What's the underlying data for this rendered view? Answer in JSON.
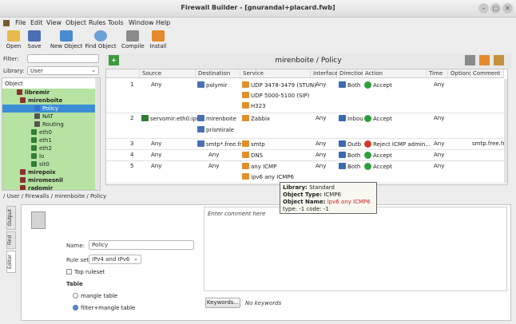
{
  "window": {
    "title": "Firewall Builder  - [gnurandal+placard.fwb]",
    "controls": [
      "–",
      "▢",
      "✕"
    ]
  },
  "menu": [
    "File",
    "Edit",
    "View",
    "Object",
    "Rules",
    "Tools",
    "Window",
    "Help"
  ],
  "toolbar": [
    {
      "label": "Open",
      "icon": "open-icon"
    },
    {
      "label": "Save",
      "icon": "save-icon"
    },
    {
      "label": "New Object",
      "icon": "new-object-icon"
    },
    {
      "label": "Find Object",
      "icon": "find-icon"
    },
    {
      "label": "Compile",
      "icon": "compile-icon"
    },
    {
      "label": "Install",
      "icon": "install-icon"
    }
  ],
  "left": {
    "filter_label": "Filter:",
    "filter_value": "",
    "library_label": "Library:",
    "library_value": "User",
    "tree_header": "Object",
    "tree": [
      {
        "label": "libremir",
        "indent": 18,
        "bold": true,
        "color": "#8b2f2f"
      },
      {
        "label": "mirenboite",
        "indent": 22,
        "bold": true,
        "color": "#8b2f2f"
      },
      {
        "label": "Policy",
        "indent": 40,
        "bold": false,
        "color": "#3b6fd0",
        "selected": true
      },
      {
        "label": "NAT",
        "indent": 40,
        "bold": false,
        "color": "#555"
      },
      {
        "label": "Routing",
        "indent": 40,
        "bold": false,
        "color": "#555"
      },
      {
        "label": "eth0",
        "indent": 36,
        "bold": false,
        "color": "#2e7d32"
      },
      {
        "label": "eth1",
        "indent": 36,
        "bold": false,
        "color": "#2e7d32"
      },
      {
        "label": "eth2",
        "indent": 36,
        "bold": false,
        "color": "#2e7d32"
      },
      {
        "label": "lo",
        "indent": 36,
        "bold": false,
        "color": "#2e7d32"
      },
      {
        "label": "sit0",
        "indent": 36,
        "bold": false,
        "color": "#2e7d32"
      },
      {
        "label": "mirepoix",
        "indent": 22,
        "bold": true,
        "color": "#8b2f2f"
      },
      {
        "label": "miromesnil",
        "indent": 22,
        "bold": true,
        "color": "#8b2f2f"
      },
      {
        "label": "radomir",
        "indent": 22,
        "bold": true,
        "color": "#8b2f2f"
      },
      {
        "label": "randomir",
        "indent": 22,
        "bold": true,
        "color": "#8b2f2f"
      }
    ]
  },
  "policy": {
    "title": "mirenboite / Policy",
    "columns": [
      "Source",
      "Destination",
      "Service",
      "Interface",
      "Direction",
      "Action",
      "Time",
      "Options",
      "Comment"
    ],
    "rows": [
      {
        "num": "1",
        "source": [
          "Any"
        ],
        "destination": [
          "polymir"
        ],
        "service": [
          "UDP 3478-3479 (STUN)",
          "UDP 5000-5100 (SIP)",
          "H323"
        ],
        "interface": "Any",
        "direction": "Both",
        "action": "Accept",
        "time": "Any",
        "comment": ""
      },
      {
        "num": "2",
        "source": [
          "servomir:eth0:ip6"
        ],
        "destination": [
          "mirenboite",
          "prismirale"
        ],
        "service": [
          "Zabbix"
        ],
        "interface": "Any",
        "direction": "Inbou",
        "action": "Accept",
        "time": "Any",
        "comment": ""
      },
      {
        "num": "3",
        "source": [
          "Any"
        ],
        "destination": [
          "smtp*.free.fr"
        ],
        "service": [
          "smtp"
        ],
        "interface": "Any",
        "direction": "Outb",
        "action": "Reject ICMP admin...",
        "time": "Any",
        "comment": "smtp.free.fr"
      },
      {
        "num": "4",
        "source": [
          "Any"
        ],
        "destination": [
          "Any"
        ],
        "service": [
          "DNS"
        ],
        "interface": "Any",
        "direction": "Both",
        "action": "Accept",
        "time": "Any",
        "comment": ""
      },
      {
        "num": "5",
        "source": [
          "Any"
        ],
        "destination": [
          "Any"
        ],
        "service": [
          "any ICMP",
          "ipv6 any ICMP6"
        ],
        "interface": "Any",
        "direction": "Both",
        "action": "Accept",
        "time": "Any",
        "comment": ""
      }
    ]
  },
  "tooltip": {
    "library_label": "Library:",
    "library": "Standard",
    "type_label": "Object Type:",
    "type": "ICMP6",
    "name_label": "Object Name:",
    "name": "ipv6 any ICMP6",
    "codes": "type: -1 code: -1"
  },
  "bottom": {
    "breadcrumb": "/ User / Firewalls / mirenboite / Policy",
    "tabs": [
      "Output",
      "Find",
      "Editor"
    ],
    "name_label": "Name:",
    "name_value": "Policy",
    "ruleset_label": "Rule set:",
    "ruleset_value": "IPv4 and IPv6",
    "top_ruleset": "Top ruleset",
    "table_label": "Table",
    "mangle_option": "mangle table",
    "filter_option": "filter+mangle table",
    "comment_placeholder": "Enter comment here",
    "keywords_button": "Keywords...",
    "keywords_value": "No keywords"
  },
  "colors": {
    "accept": "#2e9e3e",
    "reject": "#d03a2a",
    "tree_highlight": "#b6e3a2",
    "selection": "#3b8ed6"
  }
}
